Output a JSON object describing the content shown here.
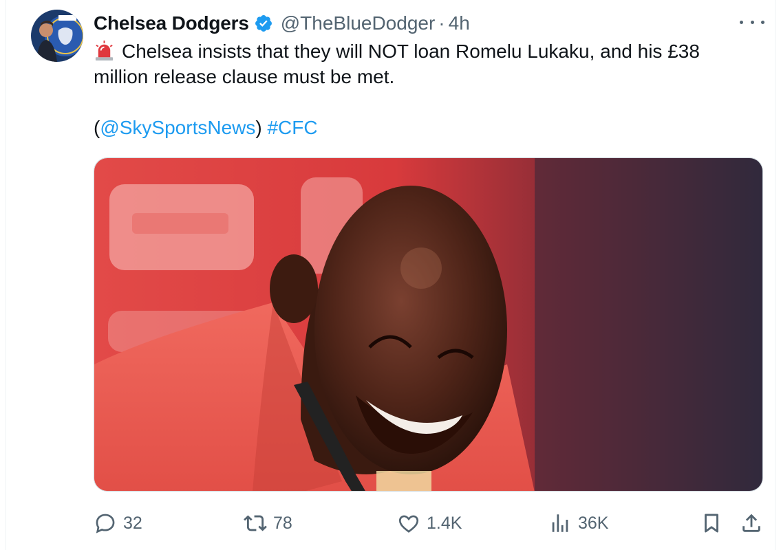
{
  "tweet": {
    "author": {
      "display_name": "Chelsea Dodgers",
      "handle": "@TheBlueDodger",
      "avatar_icon": "avatar-chelsea-crest",
      "verified_icon": "verified-badge-icon",
      "verified_color": "#1d9bf0"
    },
    "separator": "·",
    "timestamp": "4h",
    "text": {
      "emoji_icon": "police-siren-icon",
      "line1": "Chelsea insists that they will NOT loan Romelu Lukaku, and his £38",
      "line2": "million release clause must be met.",
      "open_paren": "(",
      "mention": "@SkySportsNews",
      "close_paren": ")",
      "hashtag": "#CFC"
    },
    "link_color": "#1d9bf0",
    "media": {
      "type": "photo",
      "description": "Smiling bald man in red top at a press conference with a microphone, red branded backdrop"
    },
    "actions": {
      "reply_count": "32",
      "retweet_count": "78",
      "like_count": "1.4K",
      "views_count": "36K",
      "icons": [
        "reply-icon",
        "retweet-icon",
        "like-icon",
        "views-icon",
        "bookmark-icon",
        "share-icon"
      ]
    }
  }
}
